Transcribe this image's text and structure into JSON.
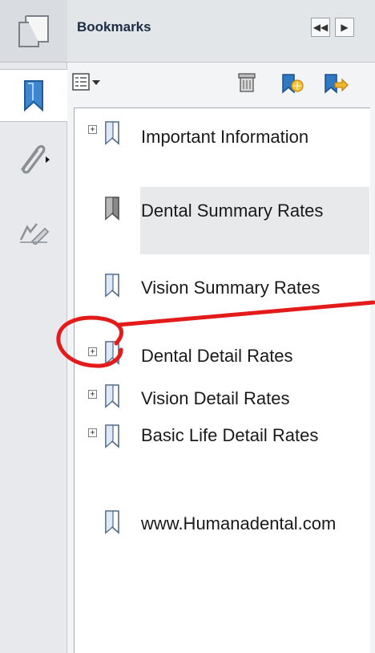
{
  "panel": {
    "title": "Bookmarks"
  },
  "bookmarks": [
    {
      "label": "Important Information",
      "expandable": true,
      "selected": false
    },
    {
      "label": "Dental Summary Rates",
      "expandable": false,
      "selected": true
    },
    {
      "label": "Vision Summary Rates",
      "expandable": false,
      "selected": false
    },
    {
      "label": "Dental Detail Rates",
      "expandable": true,
      "selected": false
    },
    {
      "label": "Vision Detail Rates",
      "expandable": true,
      "selected": false
    },
    {
      "label": "Basic Life Detail Rates",
      "expandable": true,
      "selected": false
    },
    {
      "label": "www.Humanadental.com",
      "expandable": false,
      "selected": false
    }
  ],
  "icons": {
    "pages": "pages-icon",
    "bookmark": "bookmark-icon",
    "attachment": "paperclip-icon",
    "signature": "signature-icon",
    "options": "options-menu-icon",
    "delete": "trash-icon",
    "new_bookmark": "new-bookmark-icon",
    "expand_bookmark": "expand-bookmark-icon",
    "collapse_panel": "double-left-icon",
    "expand_panel": "right-arrow-icon"
  },
  "colors": {
    "annotation": "#e41b1b",
    "bookmark_blue": "#4a87c7"
  }
}
